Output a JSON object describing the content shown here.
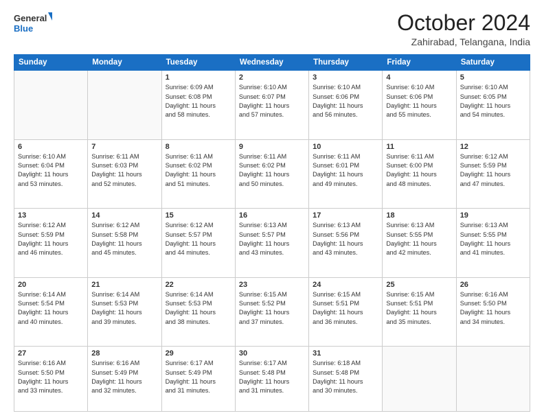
{
  "header": {
    "logo_line1": "General",
    "logo_line2": "Blue",
    "month": "October 2024",
    "location": "Zahirabad, Telangana, India"
  },
  "weekdays": [
    "Sunday",
    "Monday",
    "Tuesday",
    "Wednesday",
    "Thursday",
    "Friday",
    "Saturday"
  ],
  "weeks": [
    [
      {
        "day": "",
        "info": ""
      },
      {
        "day": "",
        "info": ""
      },
      {
        "day": "1",
        "info": "Sunrise: 6:09 AM\nSunset: 6:08 PM\nDaylight: 11 hours\nand 58 minutes."
      },
      {
        "day": "2",
        "info": "Sunrise: 6:10 AM\nSunset: 6:07 PM\nDaylight: 11 hours\nand 57 minutes."
      },
      {
        "day": "3",
        "info": "Sunrise: 6:10 AM\nSunset: 6:06 PM\nDaylight: 11 hours\nand 56 minutes."
      },
      {
        "day": "4",
        "info": "Sunrise: 6:10 AM\nSunset: 6:06 PM\nDaylight: 11 hours\nand 55 minutes."
      },
      {
        "day": "5",
        "info": "Sunrise: 6:10 AM\nSunset: 6:05 PM\nDaylight: 11 hours\nand 54 minutes."
      }
    ],
    [
      {
        "day": "6",
        "info": "Sunrise: 6:10 AM\nSunset: 6:04 PM\nDaylight: 11 hours\nand 53 minutes."
      },
      {
        "day": "7",
        "info": "Sunrise: 6:11 AM\nSunset: 6:03 PM\nDaylight: 11 hours\nand 52 minutes."
      },
      {
        "day": "8",
        "info": "Sunrise: 6:11 AM\nSunset: 6:02 PM\nDaylight: 11 hours\nand 51 minutes."
      },
      {
        "day": "9",
        "info": "Sunrise: 6:11 AM\nSunset: 6:02 PM\nDaylight: 11 hours\nand 50 minutes."
      },
      {
        "day": "10",
        "info": "Sunrise: 6:11 AM\nSunset: 6:01 PM\nDaylight: 11 hours\nand 49 minutes."
      },
      {
        "day": "11",
        "info": "Sunrise: 6:11 AM\nSunset: 6:00 PM\nDaylight: 11 hours\nand 48 minutes."
      },
      {
        "day": "12",
        "info": "Sunrise: 6:12 AM\nSunset: 5:59 PM\nDaylight: 11 hours\nand 47 minutes."
      }
    ],
    [
      {
        "day": "13",
        "info": "Sunrise: 6:12 AM\nSunset: 5:59 PM\nDaylight: 11 hours\nand 46 minutes."
      },
      {
        "day": "14",
        "info": "Sunrise: 6:12 AM\nSunset: 5:58 PM\nDaylight: 11 hours\nand 45 minutes."
      },
      {
        "day": "15",
        "info": "Sunrise: 6:12 AM\nSunset: 5:57 PM\nDaylight: 11 hours\nand 44 minutes."
      },
      {
        "day": "16",
        "info": "Sunrise: 6:13 AM\nSunset: 5:57 PM\nDaylight: 11 hours\nand 43 minutes."
      },
      {
        "day": "17",
        "info": "Sunrise: 6:13 AM\nSunset: 5:56 PM\nDaylight: 11 hours\nand 43 minutes."
      },
      {
        "day": "18",
        "info": "Sunrise: 6:13 AM\nSunset: 5:55 PM\nDaylight: 11 hours\nand 42 minutes."
      },
      {
        "day": "19",
        "info": "Sunrise: 6:13 AM\nSunset: 5:55 PM\nDaylight: 11 hours\nand 41 minutes."
      }
    ],
    [
      {
        "day": "20",
        "info": "Sunrise: 6:14 AM\nSunset: 5:54 PM\nDaylight: 11 hours\nand 40 minutes."
      },
      {
        "day": "21",
        "info": "Sunrise: 6:14 AM\nSunset: 5:53 PM\nDaylight: 11 hours\nand 39 minutes."
      },
      {
        "day": "22",
        "info": "Sunrise: 6:14 AM\nSunset: 5:53 PM\nDaylight: 11 hours\nand 38 minutes."
      },
      {
        "day": "23",
        "info": "Sunrise: 6:15 AM\nSunset: 5:52 PM\nDaylight: 11 hours\nand 37 minutes."
      },
      {
        "day": "24",
        "info": "Sunrise: 6:15 AM\nSunset: 5:51 PM\nDaylight: 11 hours\nand 36 minutes."
      },
      {
        "day": "25",
        "info": "Sunrise: 6:15 AM\nSunset: 5:51 PM\nDaylight: 11 hours\nand 35 minutes."
      },
      {
        "day": "26",
        "info": "Sunrise: 6:16 AM\nSunset: 5:50 PM\nDaylight: 11 hours\nand 34 minutes."
      }
    ],
    [
      {
        "day": "27",
        "info": "Sunrise: 6:16 AM\nSunset: 5:50 PM\nDaylight: 11 hours\nand 33 minutes."
      },
      {
        "day": "28",
        "info": "Sunrise: 6:16 AM\nSunset: 5:49 PM\nDaylight: 11 hours\nand 32 minutes."
      },
      {
        "day": "29",
        "info": "Sunrise: 6:17 AM\nSunset: 5:49 PM\nDaylight: 11 hours\nand 31 minutes."
      },
      {
        "day": "30",
        "info": "Sunrise: 6:17 AM\nSunset: 5:48 PM\nDaylight: 11 hours\nand 31 minutes."
      },
      {
        "day": "31",
        "info": "Sunrise: 6:18 AM\nSunset: 5:48 PM\nDaylight: 11 hours\nand 30 minutes."
      },
      {
        "day": "",
        "info": ""
      },
      {
        "day": "",
        "info": ""
      }
    ]
  ]
}
